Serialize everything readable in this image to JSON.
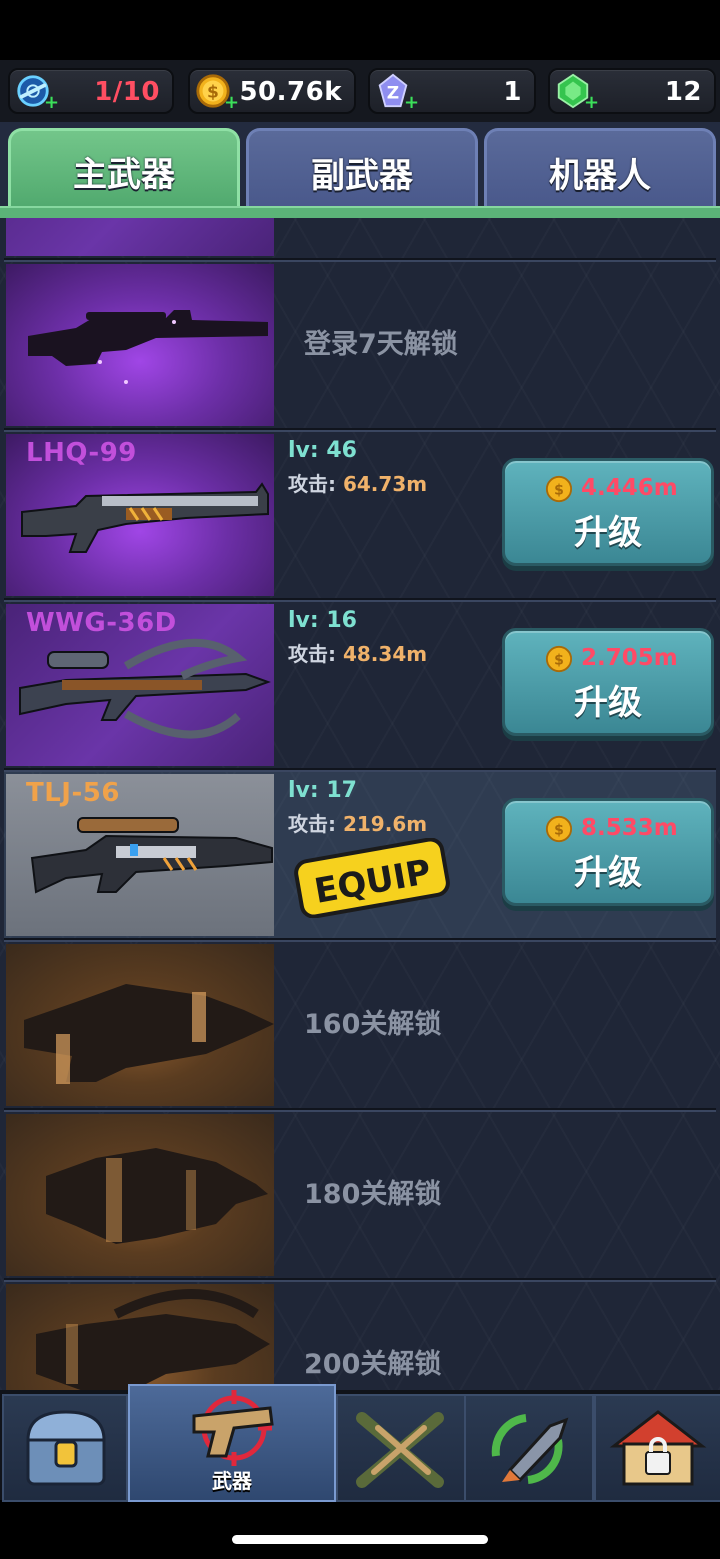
{
  "resources": [
    {
      "name": "energy-icon",
      "value": "1/10",
      "color": "#ff4e62"
    },
    {
      "name": "coin-icon",
      "value": "50.76k",
      "color": "#ffffff"
    },
    {
      "name": "z-crystal-icon",
      "value": "1",
      "color": "#ffffff"
    },
    {
      "name": "green-gem-icon",
      "value": "12",
      "color": "#ffffff"
    }
  ],
  "resource_plus": "+",
  "tabs": [
    {
      "label": "主武器",
      "active": true
    },
    {
      "label": "副武器",
      "active": false
    },
    {
      "label": "机器人",
      "active": false
    }
  ],
  "weapons": [
    {
      "locked": true,
      "lock_text": "登录7天解锁",
      "thumb": "purple-sniper"
    },
    {
      "name": "LHQ-99",
      "name_color": "#c24fdb",
      "lv_label": "lv:",
      "lv": "46",
      "atk_label": "攻击:",
      "atk": "64.73m",
      "cost": "4.446m",
      "btn": "升级",
      "thumb": "shotgun"
    },
    {
      "name": "WWG-36D",
      "name_color": "#c24fdb",
      "lv_label": "lv:",
      "lv": "16",
      "atk_label": "攻击:",
      "atk": "48.34m",
      "cost": "2.705m",
      "btn": "升级",
      "thumb": "crossbow"
    },
    {
      "name": "TLJ-56",
      "name_color": "#f0a24a",
      "lv_label": "lv:",
      "lv": "17",
      "atk_label": "攻击:",
      "atk": "219.6m",
      "cost": "8.533m",
      "btn": "升级",
      "thumb": "rifle",
      "equipped": true,
      "equip_text": "EQUIP"
    },
    {
      "locked": true,
      "lock_text": "160关解锁",
      "thumb": "locked"
    },
    {
      "locked": true,
      "lock_text": "180关解锁",
      "thumb": "locked"
    },
    {
      "locked": true,
      "lock_text": "200关解锁",
      "thumb": "locked"
    }
  ],
  "bottom_nav": [
    {
      "icon": "treasure-chest-icon",
      "label": ""
    },
    {
      "icon": "pistol-target-icon",
      "label": "武器",
      "active": true
    },
    {
      "icon": "crossed-guns-icon",
      "label": ""
    },
    {
      "icon": "missile-refresh-icon",
      "label": ""
    },
    {
      "icon": "locked-house-icon",
      "label": ""
    }
  ]
}
